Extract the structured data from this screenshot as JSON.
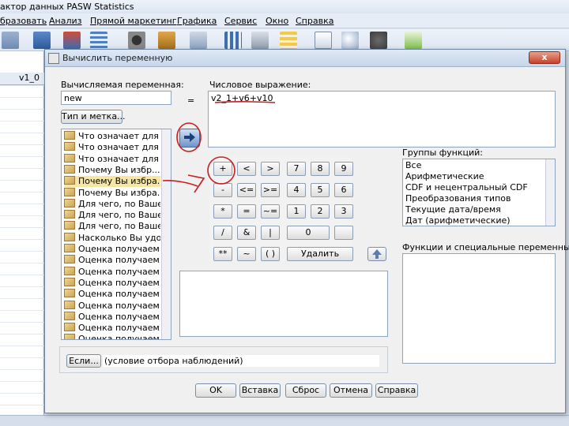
{
  "app_title": "актор данных PASW Statistics",
  "menu": [
    "бразовать",
    "Анализ",
    "Прямой маркетинг",
    "Графика",
    "Сервис",
    "Окно",
    "Справка"
  ],
  "grid": {
    "column_header": "v1_0"
  },
  "dialog": {
    "title": "Вычислить переменную",
    "close_label": "x",
    "target_label": "Вычисляемая переменная:",
    "target_value": "new",
    "equals": "=",
    "type_label_button": "Тип и метка...",
    "expression_label": "Числовое выражение:",
    "expression_value": "v2_1+v6+v10",
    "variables": [
      "Что означает для ...",
      "Что означает для ...",
      "Что означает для",
      "Почему Вы избр...",
      "Почему Вы избра...",
      "Почему Вы избра...",
      "Для чего, по Ваше...",
      "Для чего, по Ваше...",
      "Для чего, по Ваше...",
      "Насколько Вы удо...",
      "Оценка получаем...",
      "Оценка получаем...",
      "Оценка получаем...",
      "Оценка получаем...",
      "Оценка получаем...",
      "Оценка получаем...",
      "Оценка получаем...",
      "Оценка получаем...",
      "Оценка получаем..."
    ],
    "selected_variable_index": 4,
    "keypad": [
      [
        "+",
        "<",
        ">",
        "7",
        "8",
        "9"
      ],
      [
        "-",
        "<=",
        ">=",
        "4",
        "5",
        "6"
      ],
      [
        "*",
        "=",
        "~=",
        "1",
        "2",
        "3"
      ],
      [
        "/",
        "&",
        "|",
        "0",
        ""
      ],
      [
        "**",
        "~",
        "( )",
        "Удалить"
      ]
    ],
    "function_groups_label": "Группы функций:",
    "function_groups": [
      "Все",
      "Арифметические",
      "CDF и нецентральный CDF",
      "Преобразования типов",
      "Текущие дата/время",
      "Дат (арифметические)"
    ],
    "functions_label": "Функции и специальные переменные:",
    "if_button": "Если...",
    "if_text": "(условие отбора наблюдений)",
    "buttons": {
      "ok": "OK",
      "paste": "Вставка",
      "reset": "Сброс",
      "cancel": "Отмена",
      "help": "Справка"
    }
  }
}
